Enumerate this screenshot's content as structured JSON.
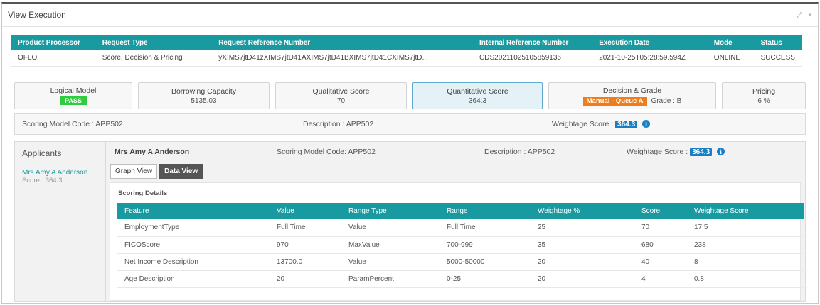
{
  "window": {
    "title": "View Execution",
    "controls": [
      "⤢",
      "×"
    ]
  },
  "request_table": {
    "headers": [
      "Product Processor",
      "Request Type",
      "Request Reference Number",
      "Internal Reference Number",
      "Execution Date",
      "Mode",
      "Status"
    ],
    "row": [
      "OFLO",
      "Score, Decision & Pricing",
      "yXIMS7jtD41zXIMS7jtD41AXIMS7jtD41BXIMS7jtD41CXIMS7jtD...",
      "CDS20211025105859136",
      "2021-10-25T05:28:59.594Z",
      "ONLINE",
      "SUCCESS"
    ]
  },
  "cards": {
    "logical_model": {
      "title": "Logical Model",
      "badge": "PASS"
    },
    "borrowing_capacity": {
      "title": "Borrowing Capacity",
      "value": "5135.03"
    },
    "qualitative_score": {
      "title": "Qualitative Score",
      "value": "70"
    },
    "quantitative_score": {
      "title": "Quantitative Score",
      "value": "364.3"
    },
    "decision_grade": {
      "title": "Decision & Grade",
      "badge": "Manual - Queue A",
      "grade": "Grade : B"
    },
    "pricing": {
      "title": "Pricing",
      "value": "6 %"
    }
  },
  "model_bar": {
    "code": "Scoring Model Code : APP502",
    "description": "Description : APP502",
    "weightage_label": "Weightage Score :",
    "weightage_value": "364.3"
  },
  "applicants": {
    "heading": "Applicants",
    "items": [
      {
        "name": "Mrs Amy A Anderson",
        "score": "Score : 364.3"
      }
    ]
  },
  "applicant_detail": {
    "name": "Mrs Amy A Anderson",
    "code": "Scoring Model Code: APP502",
    "description": "Description : APP502",
    "weightage_label": "Weightage Score :",
    "weightage_value": "364.3",
    "tabs": [
      "Graph View",
      "Data View"
    ],
    "section_title": "Scoring Details",
    "table": {
      "headers": [
        "Feature",
        "Value",
        "Range Type",
        "Range",
        "Weightage %",
        "Score",
        "Weightage Score"
      ],
      "rows": [
        [
          "EmploymentType",
          "Full Time",
          "Value",
          "Full Time",
          "25",
          "70",
          "17.5"
        ],
        [
          "FICOScore",
          "970",
          "MaxValue",
          "700-999",
          "35",
          "680",
          "238"
        ],
        [
          "Net Income Description",
          "13700.0",
          "Value",
          "5000-50000",
          "20",
          "40",
          "8"
        ],
        [
          "Age Description",
          "20",
          "ParamPercent",
          "0-25",
          "20",
          "4",
          "0.8"
        ]
      ]
    }
  },
  "colors": {
    "teal": "#199aa1",
    "pass": "#2ecc40",
    "queue": "#f07c1b",
    "score_badge": "#1a7fc2"
  }
}
